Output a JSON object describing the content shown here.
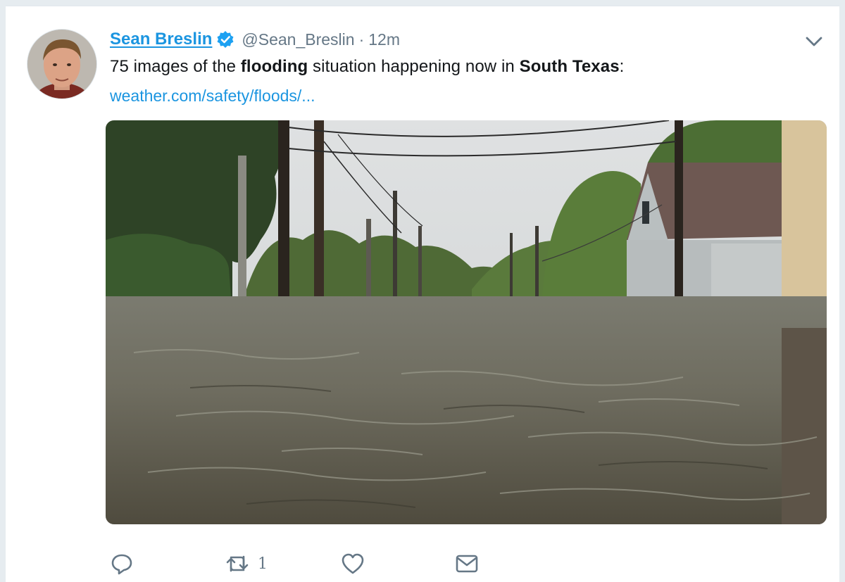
{
  "tweet": {
    "author": {
      "display_name": "Sean Breslin",
      "handle": "@Sean_Breslin",
      "verified": true,
      "avatar_icon": "user-avatar-photo"
    },
    "separator": "·",
    "time": "12m",
    "text": {
      "t1": "75 images of the ",
      "b1": "flooding",
      "t2": " situation happening now in ",
      "b2": "South Texas",
      "t3": ":"
    },
    "link": "weather.com/safety/floods/...",
    "media": {
      "type": "photo",
      "icon": "photo-flooded-street"
    },
    "actions": {
      "reply_icon": "reply-icon",
      "retweet_icon": "retweet-icon",
      "retweet_count": "1",
      "like_icon": "heart-icon",
      "dm_icon": "envelope-icon"
    }
  },
  "colors": {
    "link": "#1b95e0",
    "text": "#14171a",
    "muted": "#657786",
    "background": "#e6ecf0",
    "card": "#ffffff"
  }
}
